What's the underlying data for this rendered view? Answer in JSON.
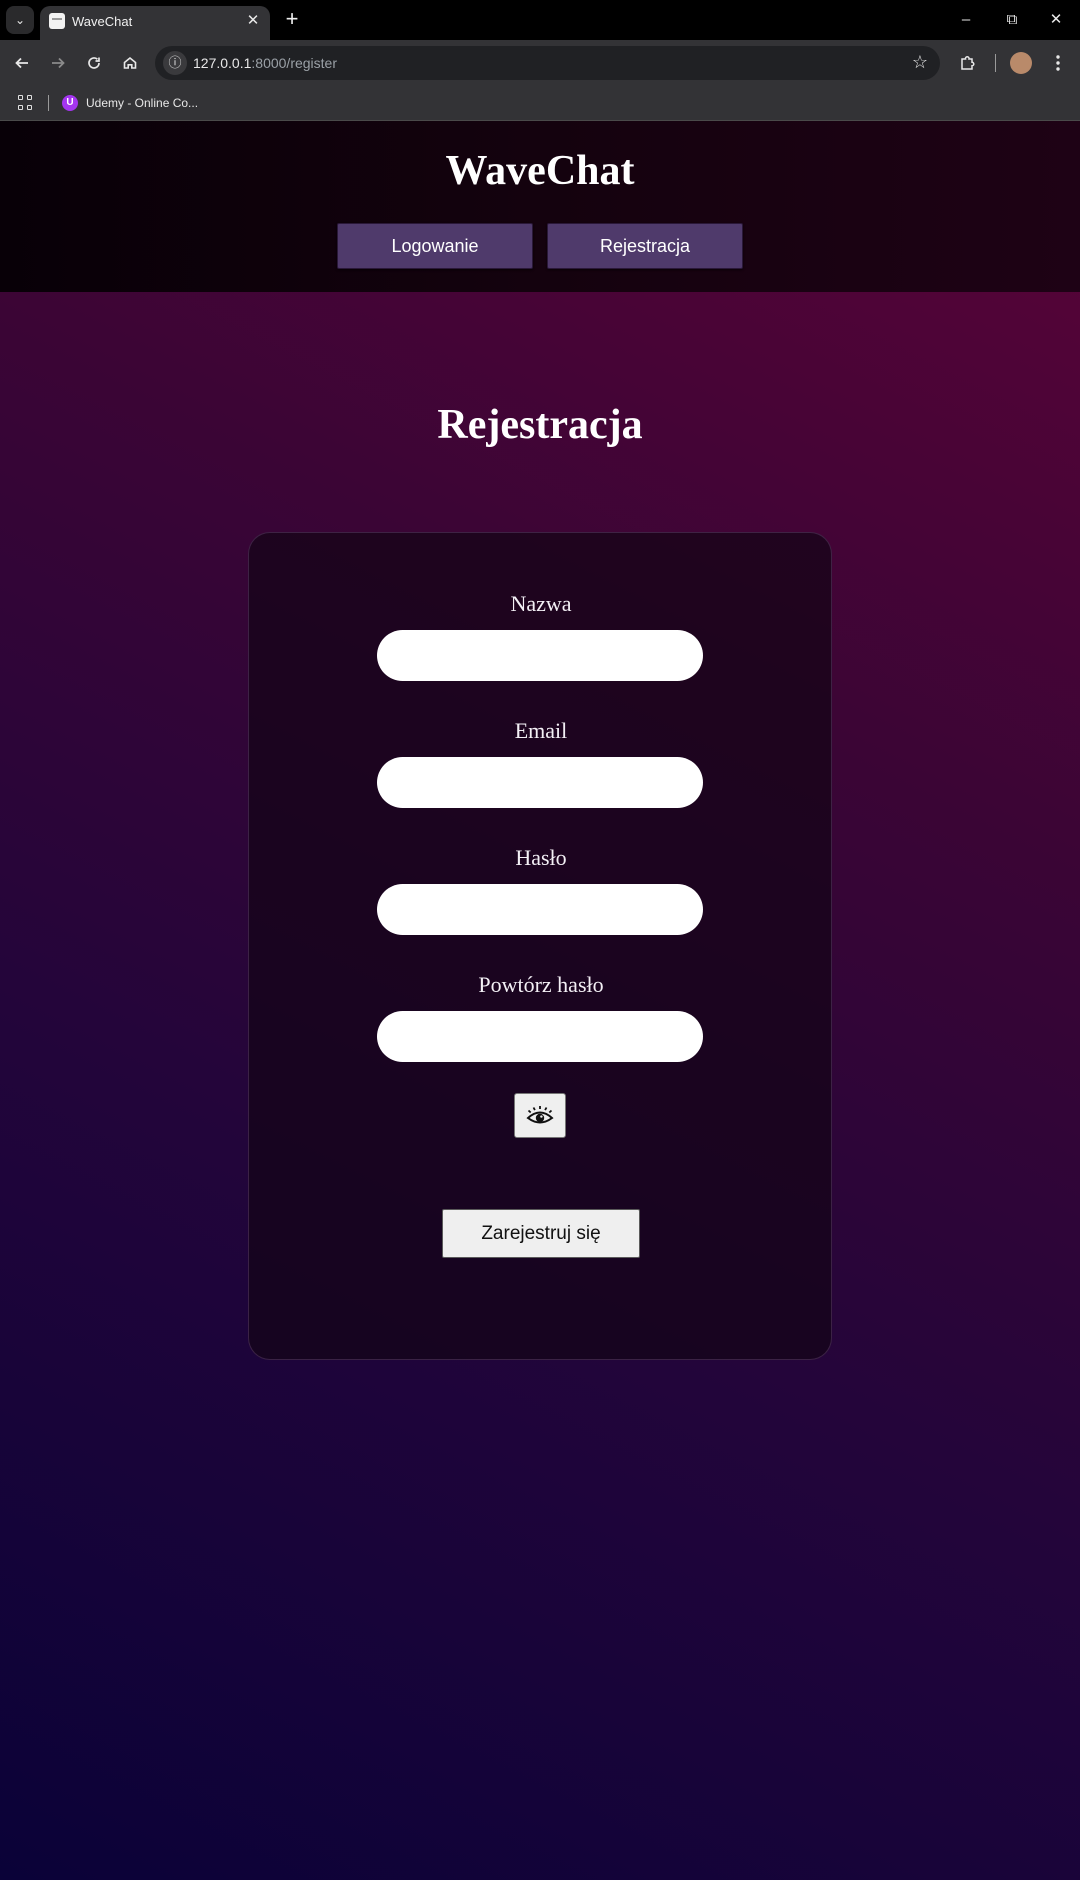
{
  "browser": {
    "tab_title": "WaveChat",
    "url_host": "127.0.0.1",
    "url_rest": ":8000/register",
    "bookmark_label": "Udemy - Online Co..."
  },
  "header": {
    "title": "WaveChat",
    "nav": {
      "login_label": "Logowanie",
      "register_label": "Rejestracja"
    }
  },
  "main": {
    "heading": "Rejestracja",
    "form": {
      "name_label": "Nazwa",
      "name_value": "",
      "email_label": "Email",
      "email_value": "",
      "password_label": "Hasło",
      "password_value": "",
      "repeat_password_label": "Powtórz hasło",
      "repeat_password_value": "",
      "toggle_visibility_icon": "eye-icon",
      "submit_label": "Zarejestruj się"
    }
  },
  "colors": {
    "nav_button": "#4f3a6b",
    "card_background": "#140416",
    "gradient_top": "#5a0338",
    "gradient_bottom": "#0a0238"
  }
}
